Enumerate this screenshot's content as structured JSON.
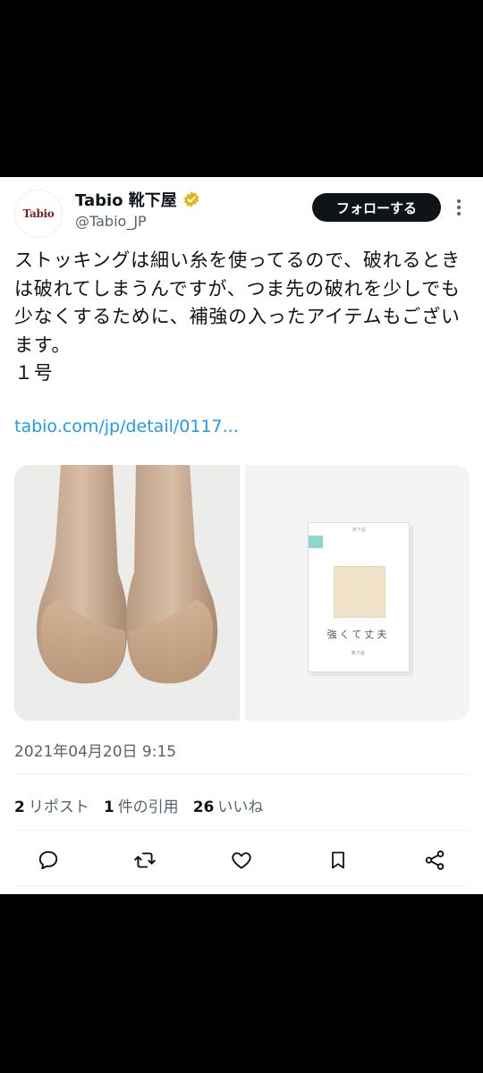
{
  "account": {
    "avatar_text": "Tabio",
    "display_name": "Tabio 靴下屋",
    "handle": "@Tabio_JP",
    "verified": true
  },
  "follow_label": "フォローする",
  "tweet": {
    "text": "ストッキングは細い糸を使ってるので、破れるときは破れてしまうんですが、つま先の破れを少しでも少なくするために、補強の入ったアイテムもございます。\n１号",
    "link": "tabio.com/jp/detail/0117..."
  },
  "product_package": {
    "header": "靴下屋",
    "caption": "強くて丈夫",
    "footer": "靴下屋"
  },
  "timestamp": "2021年04月20日 9:15",
  "stats": [
    {
      "count": "2",
      "label": "リポスト"
    },
    {
      "count": "1",
      "label": "件の引用"
    },
    {
      "count": "26",
      "label": "いいね"
    }
  ],
  "icons": [
    "more-icon",
    "verified-badge-icon",
    "reply-icon",
    "repost-icon",
    "like-icon",
    "bookmark-icon",
    "share-icon"
  ],
  "colors": {
    "link": "#1d9bf0",
    "verified": "#e2b719",
    "text": "#0f1419",
    "muted": "#536471",
    "package_accent": "#8fd6cf"
  }
}
